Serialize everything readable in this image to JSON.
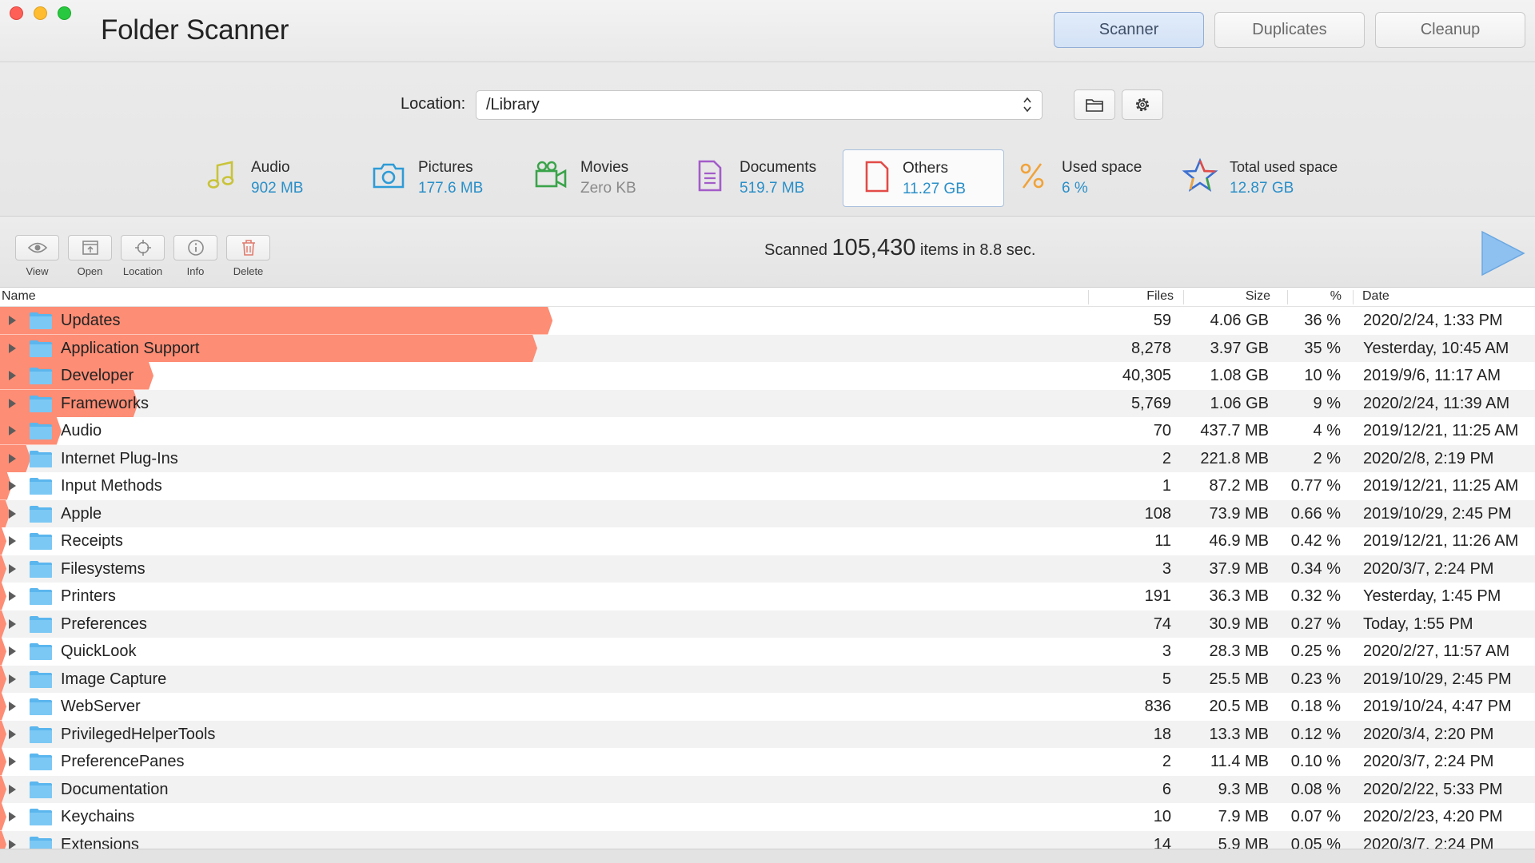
{
  "app": {
    "title": "Folder Scanner"
  },
  "modes": {
    "scanner": "Scanner",
    "duplicates": "Duplicates",
    "cleanup": "Cleanup"
  },
  "location": {
    "label": "Location:",
    "value": "/Library"
  },
  "stats": {
    "audio": {
      "label": "Audio",
      "value": "902 MB",
      "icon": "music-note-icon",
      "color": "#c9c33a"
    },
    "pictures": {
      "label": "Pictures",
      "value": "177.6 MB",
      "icon": "camera-icon",
      "color": "#2e9bd6"
    },
    "movies": {
      "label": "Movies",
      "value": "Zero KB",
      "icon": "video-camera-icon",
      "color": "#3aa34a"
    },
    "documents": {
      "label": "Documents",
      "value": "519.7 MB",
      "icon": "document-icon",
      "color": "#a35cc9"
    },
    "others": {
      "label": "Others",
      "value": "11.27 GB",
      "icon": "file-icon",
      "color": "#e24b47"
    },
    "used": {
      "label": "Used space",
      "value": "6 %",
      "icon": "percent-icon",
      "color": "#f0a33a"
    },
    "total": {
      "label": "Total used space",
      "value": "12.87 GB",
      "icon": "star-icon"
    }
  },
  "toolbar": {
    "view": "View",
    "open": "Open",
    "location": "Location",
    "info": "Info",
    "delete": "Delete"
  },
  "scan": {
    "prefix": "Scanned",
    "count": "105,430",
    "suffix": "items in 8.8 sec."
  },
  "table": {
    "headers": {
      "name": "Name",
      "files": "Files",
      "size": "Size",
      "pct": "%",
      "date": "Date"
    },
    "rows": [
      {
        "name": "Updates",
        "files": "59",
        "size": "4.06 GB",
        "pct": "36 %",
        "date": "2020/2/24, 1:33 PM",
        "share": 36
      },
      {
        "name": "Application Support",
        "files": "8,278",
        "size": "3.97 GB",
        "pct": "35 %",
        "date": "Yesterday, 10:45 AM",
        "share": 35
      },
      {
        "name": "Developer",
        "files": "40,305",
        "size": "1.08 GB",
        "pct": "10 %",
        "date": "2019/9/6, 11:17 AM",
        "share": 10
      },
      {
        "name": "Frameworks",
        "files": "5,769",
        "size": "1.06 GB",
        "pct": "9 %",
        "date": "2020/2/24, 11:39 AM",
        "share": 9
      },
      {
        "name": "Audio",
        "files": "70",
        "size": "437.7 MB",
        "pct": "4 %",
        "date": "2019/12/21, 11:25 AM",
        "share": 4
      },
      {
        "name": "Internet Plug-Ins",
        "files": "2",
        "size": "221.8 MB",
        "pct": "2 %",
        "date": "2020/2/8, 2:19 PM",
        "share": 2
      },
      {
        "name": "Input Methods",
        "files": "1",
        "size": "87.2 MB",
        "pct": "0.77 %",
        "date": "2019/12/21, 11:25 AM",
        "share": 0.77
      },
      {
        "name": "Apple",
        "files": "108",
        "size": "73.9 MB",
        "pct": "0.66 %",
        "date": "2019/10/29, 2:45 PM",
        "share": 0.66
      },
      {
        "name": "Receipts",
        "files": "11",
        "size": "46.9 MB",
        "pct": "0.42 %",
        "date": "2019/12/21, 11:26 AM",
        "share": 0.42
      },
      {
        "name": "Filesystems",
        "files": "3",
        "size": "37.9 MB",
        "pct": "0.34 %",
        "date": "2020/3/7, 2:24 PM",
        "share": 0.34
      },
      {
        "name": "Printers",
        "files": "191",
        "size": "36.3 MB",
        "pct": "0.32 %",
        "date": "Yesterday, 1:45 PM",
        "share": 0.32
      },
      {
        "name": "Preferences",
        "files": "74",
        "size": "30.9 MB",
        "pct": "0.27 %",
        "date": "Today, 1:55 PM",
        "share": 0.27
      },
      {
        "name": "QuickLook",
        "files": "3",
        "size": "28.3 MB",
        "pct": "0.25 %",
        "date": "2020/2/27, 11:57 AM",
        "share": 0.25
      },
      {
        "name": "Image Capture",
        "files": "5",
        "size": "25.5 MB",
        "pct": "0.23 %",
        "date": "2019/10/29, 2:45 PM",
        "share": 0.23
      },
      {
        "name": "WebServer",
        "files": "836",
        "size": "20.5 MB",
        "pct": "0.18 %",
        "date": "2019/10/24, 4:47 PM",
        "share": 0.18
      },
      {
        "name": "PrivilegedHelperTools",
        "files": "18",
        "size": "13.3 MB",
        "pct": "0.12 %",
        "date": "2020/3/4, 2:20 PM",
        "share": 0.12
      },
      {
        "name": "PreferencePanes",
        "files": "2",
        "size": "11.4 MB",
        "pct": "0.10 %",
        "date": "2020/3/7, 2:24 PM",
        "share": 0.1
      },
      {
        "name": "Documentation",
        "files": "6",
        "size": "9.3 MB",
        "pct": "0.08 %",
        "date": "2020/2/22, 5:33 PM",
        "share": 0.08
      },
      {
        "name": "Keychains",
        "files": "10",
        "size": "7.9 MB",
        "pct": "0.07 %",
        "date": "2020/2/23, 4:20 PM",
        "share": 0.07
      },
      {
        "name": "Extensions",
        "files": "14",
        "size": "5.9 MB",
        "pct": "0.05 %",
        "date": "2020/3/7, 2:24 PM",
        "share": 0.05
      }
    ]
  }
}
